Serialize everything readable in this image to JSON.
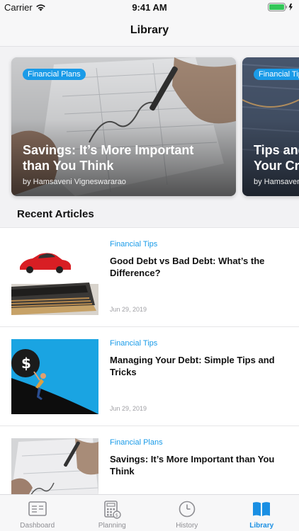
{
  "status_bar": {
    "carrier": "Carrier",
    "time": "9:41 AM"
  },
  "nav": {
    "title": "Library"
  },
  "featured": [
    {
      "tag": "Financial Plans",
      "title_line1": "Savings: It’s More Important",
      "title_line2": "than You Think",
      "author": "by Hamsaveni Vigneswararao"
    },
    {
      "tag": "Financial Tips",
      "title_line1": "Tips and",
      "title_line2": "Your Cr",
      "author": "by Hamsaveni"
    }
  ],
  "recent_heading": "Recent Articles",
  "articles": [
    {
      "tag": "Financial Tips",
      "title": "Good Debt vs Bad Debt: What’s the Difference?",
      "date": "Jun 29, 2019",
      "image": "car-and-wallet-image"
    },
    {
      "tag": "Financial Tips",
      "title": "Managing Your Debt: Simple Tips and Tricks",
      "date": "Jun 29, 2019",
      "image": "person-pushing-dollar-ball-image"
    },
    {
      "tag": "Financial Plans",
      "title": "Savings: It’s More Important than You Think",
      "date": "",
      "image": "writing-savings-image"
    }
  ],
  "tabs": [
    {
      "label": "Dashboard",
      "icon": "dashboard-icon",
      "active": false
    },
    {
      "label": "Planning",
      "icon": "calculator-icon",
      "active": false
    },
    {
      "label": "History",
      "icon": "clock-icon",
      "active": false
    },
    {
      "label": "Library",
      "icon": "book-icon",
      "active": true
    }
  ],
  "colors": {
    "accent": "#1a9be8",
    "active_tab": "#1a8fe3",
    "inactive_tab": "#8e8e93"
  }
}
